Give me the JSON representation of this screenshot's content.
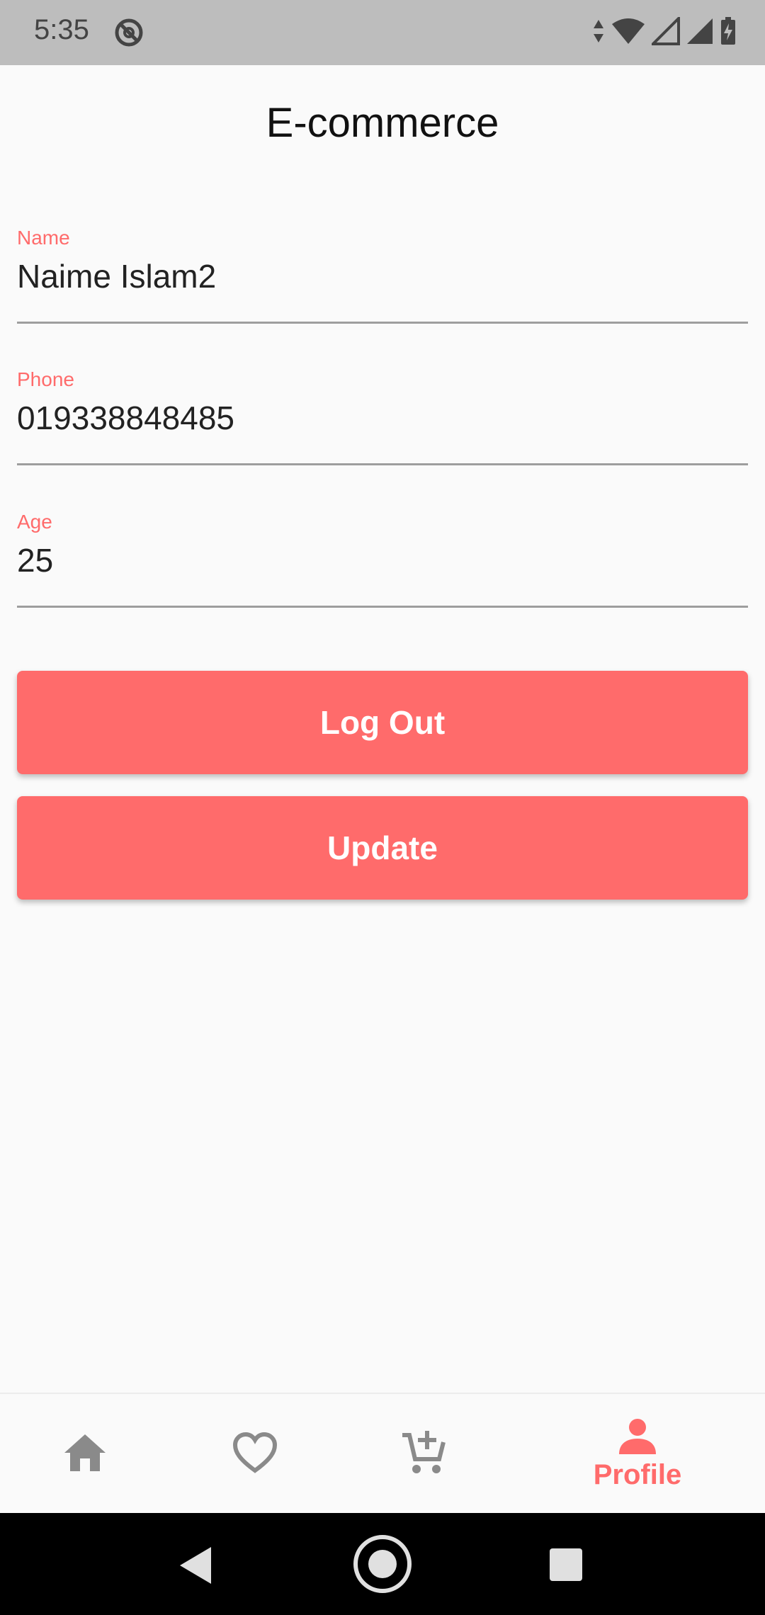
{
  "status_bar": {
    "time": "5:35"
  },
  "app_bar": {
    "title": "E-commerce"
  },
  "form": {
    "name": {
      "label": "Name",
      "value": "Naime Islam2"
    },
    "phone": {
      "label": "Phone",
      "value": "019338848485"
    },
    "age": {
      "label": "Age",
      "value": "25"
    }
  },
  "buttons": {
    "logout": "Log Out",
    "update": "Update"
  },
  "bottom_nav": {
    "items": [
      {
        "icon": "home-icon",
        "label": ""
      },
      {
        "icon": "heart-outline-icon",
        "label": ""
      },
      {
        "icon": "cart-add-icon",
        "label": ""
      },
      {
        "icon": "person-icon",
        "label": "Profile",
        "active": true
      }
    ]
  },
  "colors": {
    "accent": "#ff6b6b",
    "inactive_icon": "#8a8a8a",
    "status_bar": "#bdbdbd"
  }
}
